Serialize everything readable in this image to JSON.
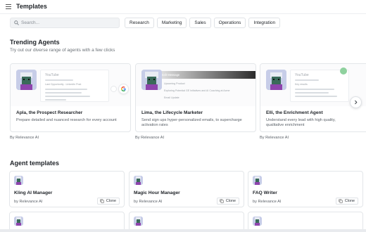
{
  "app": {
    "title": "Templates"
  },
  "search": {
    "placeholder": "Search..."
  },
  "filters": [
    "Research",
    "Marketing",
    "Sales",
    "Operations",
    "Integration"
  ],
  "trending": {
    "title": "Trending Agents",
    "subtitle": "Try out our diverse range of agents with a few clicks",
    "cards": [
      {
        "name": "Apla, the Prospect Researcher",
        "description": "Prepare detailed and nuanced research for every account",
        "by": "By Relevance AI",
        "preview_heading": "YouTube",
        "preview_lines": [
          "Last Opportunity - LinkedIn Post"
        ]
      },
      {
        "name": "Lima, the Lifecycle Marketer",
        "description": "Send sign ups hyper-personalized emails, to supercharge activation rates",
        "by": "By Relevance AI",
        "preview_heading": "Draft Message",
        "preview_lines": [
          "Upcoming Product",
          "Exploring Potential GE Initiatives and AI Coaching at Acme",
          "Email Update"
        ]
      },
      {
        "name": "Elli, the Enrichment Agent",
        "description": "Understand every lead with high quality, qualitative enrichment",
        "by": "By Relevance AI",
        "preview_heading": "YouTube",
        "preview_lines": [
          "Key results"
        ]
      }
    ]
  },
  "templates": {
    "title": "Agent templates",
    "items": [
      {
        "name": "Kling AI Manager",
        "by": "by Relevance AI",
        "clone_label": "Clone"
      },
      {
        "name": "Magic Hour Manager",
        "by": "by Relevance AI",
        "clone_label": "Clone"
      },
      {
        "name": "FAQ Writer",
        "by": "by Relevance AI",
        "clone_label": "Clone"
      }
    ]
  },
  "colors": {
    "avatar_bg": "#c7cde8",
    "avatar_hair": "#e9ecf3",
    "avatar_skin": "#3a6b5a",
    "avatar_shirt": "#8e44ad",
    "accent_green": "#8fd19e"
  },
  "icons": {
    "menu": "menu-icon",
    "search": "search-icon",
    "next": "chevron-right-icon",
    "clone": "copy-icon",
    "google": "google-icon"
  }
}
